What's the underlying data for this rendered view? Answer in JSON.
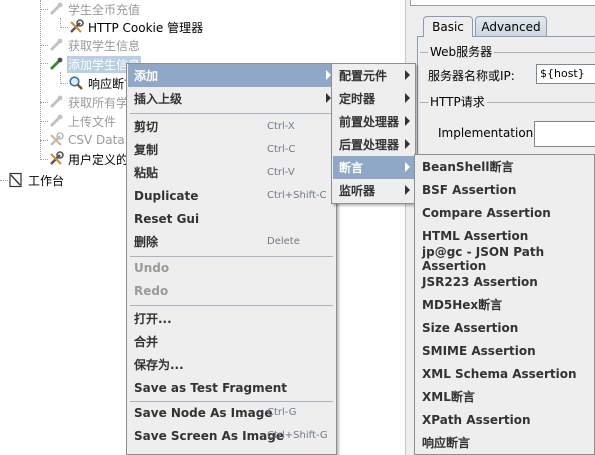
{
  "tree": {
    "items": [
      {
        "label": "学生全币充值",
        "state": "disabled",
        "icon": "pipette-icon"
      },
      {
        "label": "HTTP Cookie 管理器",
        "state": "normal",
        "icon": "wrench-icon"
      },
      {
        "label": "获取学生信息",
        "state": "disabled",
        "icon": "pipette-icon"
      },
      {
        "label": "添加学生信息",
        "state": "selected",
        "icon": "pipette-icon"
      },
      {
        "label": "响应断言",
        "state": "normal",
        "icon": "magnifier-icon"
      },
      {
        "label": "获取所有学生",
        "state": "disabled",
        "icon": "pipette-icon"
      },
      {
        "label": "上传文件",
        "state": "disabled",
        "icon": "pipette-icon"
      },
      {
        "label": "CSV Data",
        "state": "disabled",
        "icon": "wrench-icon"
      },
      {
        "label": "用户定义的",
        "state": "normal",
        "icon": "wrench-icon"
      },
      {
        "label": "工作台",
        "state": "normal",
        "icon": "workbench-icon"
      }
    ]
  },
  "right_pane": {
    "top_field_value": "",
    "tabs": [
      {
        "label": "Basic",
        "active": true
      },
      {
        "label": "Advanced",
        "active": false
      }
    ],
    "web_server_title": "Web服务器",
    "server_name_label": "服务器名称或IP:",
    "server_name_value": "${host}",
    "http_request_title": "HTTP请求",
    "implementation_label": "Implementation:",
    "implementation_value": ""
  },
  "context_menu": {
    "groups": [
      [
        {
          "label": "添加",
          "submenu": true,
          "active": true
        },
        {
          "label": "插入上级",
          "submenu": true
        }
      ],
      [
        {
          "label": "剪切",
          "accelerator": "Ctrl-X"
        },
        {
          "label": "复制",
          "accelerator": "Ctrl-C"
        },
        {
          "label": "粘贴",
          "accelerator": "Ctrl-V"
        },
        {
          "label": "Duplicate",
          "accelerator": "Ctrl+Shift-C"
        },
        {
          "label": "Reset Gui"
        },
        {
          "label": "删除",
          "accelerator": "Delete"
        }
      ],
      [
        {
          "label": "Undo",
          "disabled": true
        },
        {
          "label": "Redo",
          "disabled": true
        }
      ],
      [
        {
          "label": "打开..."
        },
        {
          "label": "合并"
        },
        {
          "label": "保存为..."
        },
        {
          "label": "Save as Test Fragment"
        }
      ],
      [
        {
          "label": "Save Node As Image",
          "accelerator": "Ctrl-G"
        },
        {
          "label": "Save Screen As Image",
          "accelerator": "Ctrl+Shift-G"
        }
      ]
    ]
  },
  "add_submenu": {
    "items": [
      {
        "label": "配置元件",
        "submenu": true
      },
      {
        "label": "定时器",
        "submenu": true
      },
      {
        "label": "前置处理器",
        "submenu": true
      },
      {
        "label": "后置处理器",
        "submenu": true
      },
      {
        "label": "断言",
        "submenu": true,
        "active": true
      },
      {
        "label": "监听器",
        "submenu": true
      }
    ]
  },
  "assertion_submenu": {
    "items": [
      "BeanShell断言",
      "BSF Assertion",
      "Compare Assertion",
      "HTML Assertion",
      "jp@gc - JSON Path Assertion",
      "JSR223 Assertion",
      "MD5Hex断言",
      "Size Assertion",
      "SMIME Assertion",
      "XML Schema Assertion",
      "XML断言",
      "XPath Assertion",
      "响应断言"
    ]
  },
  "colors": {
    "menu_background": "#eeeeee",
    "menu_highlight": "#8fa8c8",
    "selected_tree_background": "#b8cfe5",
    "disabled_text": "#9a9a9a"
  }
}
